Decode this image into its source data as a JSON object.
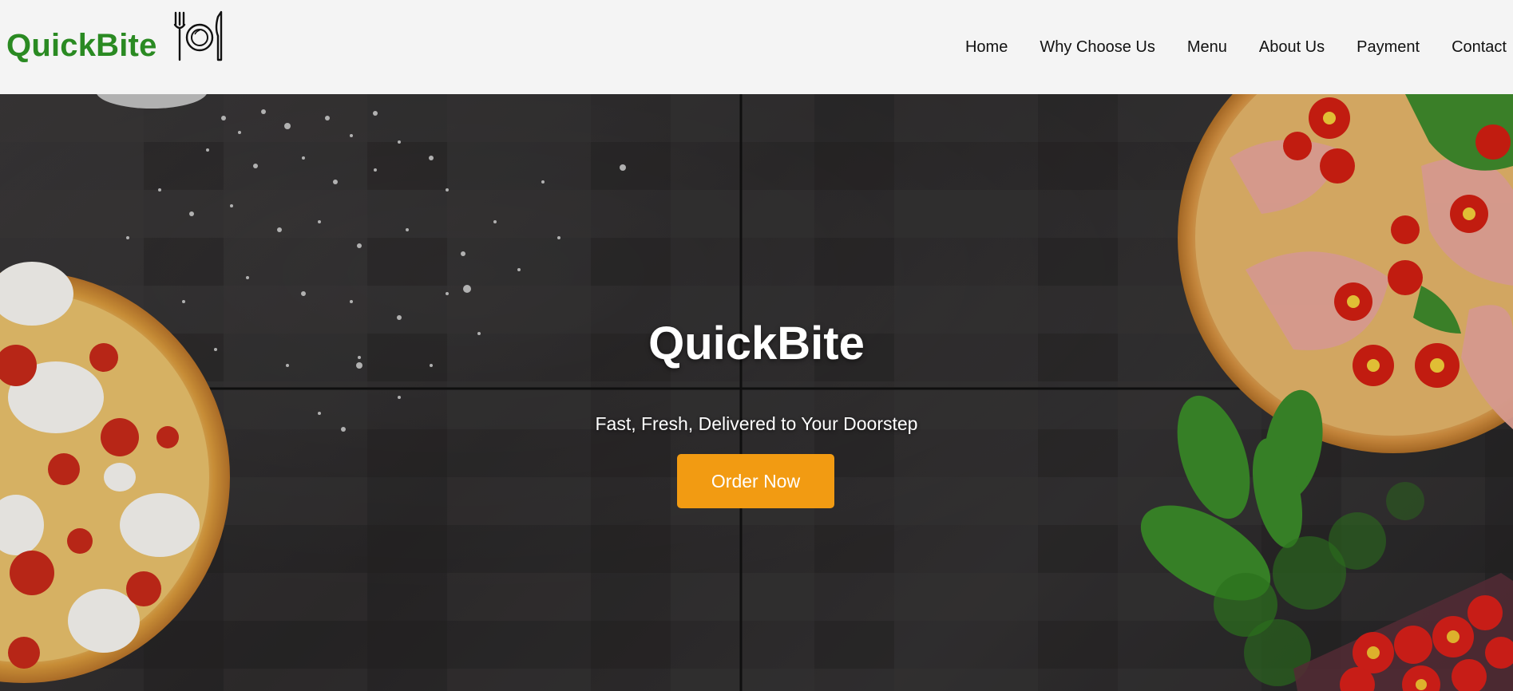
{
  "brand": {
    "name": "QuickBite",
    "icon": "plate-fork-knife-icon",
    "color": "#2a8a22"
  },
  "nav": {
    "items": [
      {
        "label": "Home"
      },
      {
        "label": "Why Choose Us"
      },
      {
        "label": "Menu"
      },
      {
        "label": "About Us"
      },
      {
        "label": "Payment"
      },
      {
        "label": "Contact"
      }
    ]
  },
  "hero": {
    "title": "QuickBite",
    "tagline": "Fast, Fresh, Delivered to Your Doorstep",
    "cta_label": "Order Now",
    "cta_color": "#f29b12"
  }
}
